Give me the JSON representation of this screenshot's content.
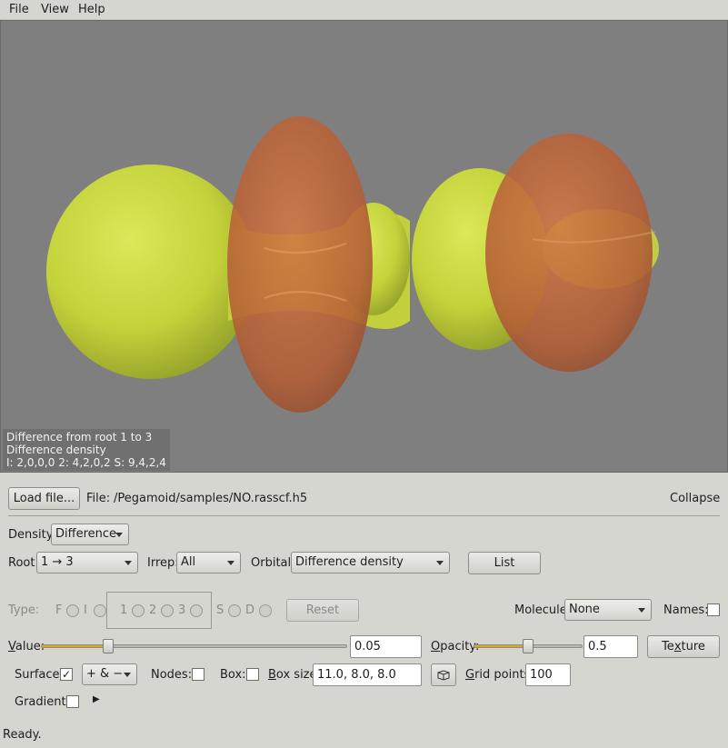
{
  "menu": {
    "file": "File",
    "view": "View",
    "help": "Help"
  },
  "overlay": {
    "line1": "Difference from root 1 to 3",
    "line2": "Difference density",
    "line3": "I: 2,0,0,0   2: 4,2,0,2   S: 9,4,2,4"
  },
  "file_row": {
    "load_button": "Load file...",
    "file_label": "File:",
    "file_path": "/Pegamoid/samples/NO.rasscf.h5",
    "collapse": "Collapse"
  },
  "density": {
    "label": "Density:",
    "value": "Difference"
  },
  "root": {
    "label": "Root:",
    "value": "1 → 3"
  },
  "irrep": {
    "label": "Irrep:",
    "value": "All"
  },
  "orbital": {
    "label": "Orbital:",
    "value": "Difference density"
  },
  "list_button": "List",
  "type": {
    "label": "Type:",
    "options": [
      "F",
      "I",
      "1",
      "2",
      "3",
      "S",
      "D"
    ]
  },
  "reset_button": "Reset",
  "molecule": {
    "label": "Molecule:",
    "value": "None"
  },
  "names": {
    "label": "Names:",
    "checked": false
  },
  "value": {
    "label": "Value:",
    "text": "0.05",
    "level": 0.22
  },
  "opacity": {
    "label": "Opacity:",
    "text": "0.5",
    "level": 0.5
  },
  "texture_button": "Texture",
  "surface": {
    "label": "Surface:",
    "checked": true,
    "mode": "+ & −"
  },
  "nodes": {
    "label": "Nodes:",
    "checked": false
  },
  "box": {
    "label": "Box:",
    "checked": false
  },
  "box_size": {
    "label": "Box size:",
    "value": "11.0, 8.0, 8.0"
  },
  "grid_points": {
    "label": "Grid points:",
    "value": "100"
  },
  "gradient": {
    "label": "Gradient:",
    "checked": false
  },
  "status": "Ready.",
  "colors": {
    "positive_lobe": "#c9d93e",
    "negative_lobe": "#c46a3c",
    "viewport_bg": "#7f7f7f",
    "slider_fill": "#e3a622"
  }
}
